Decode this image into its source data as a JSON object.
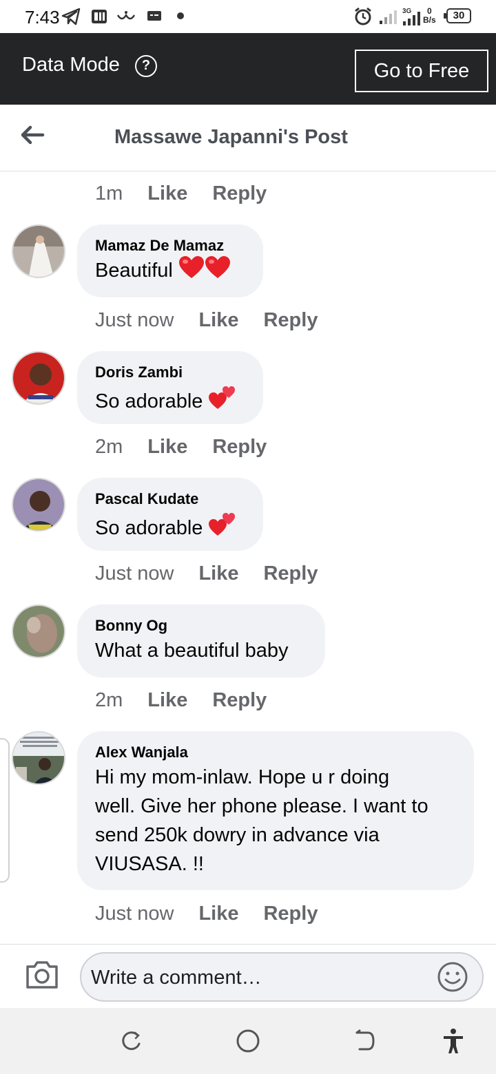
{
  "status_bar": {
    "time": "7:43",
    "net_speed": "0",
    "net_unit": "B/s",
    "net_type": "3G",
    "battery": "30"
  },
  "data_mode": {
    "label": "Data Mode",
    "help_glyph": "?",
    "go_free_label": "Go to Free"
  },
  "header": {
    "title": "Massawe Japanni's Post"
  },
  "comments": [
    {
      "author": "",
      "text": "",
      "time": "1m",
      "like": "Like",
      "reply": "Reply"
    },
    {
      "author": "Mamaz De Mamaz",
      "text": "Beautiful",
      "emoji": "red-heart-x2",
      "time": "Just now",
      "like": "Like",
      "reply": "Reply"
    },
    {
      "author": "Doris Zambi",
      "text": "So adorable",
      "emoji": "two-hearts",
      "time": "2m",
      "like": "Like",
      "reply": "Reply"
    },
    {
      "author": "Pascal Kudate",
      "text": "So adorable",
      "emoji": "two-hearts",
      "time": "Just now",
      "like": "Like",
      "reply": "Reply"
    },
    {
      "author": "Bonny Og",
      "text": "What a beautiful baby",
      "time": "2m",
      "like": "Like",
      "reply": "Reply"
    },
    {
      "author": "Alex Wanjala",
      "text_lines": [
        "Hi my mom-inlaw. Hope u r doing",
        "well. Give her phone please. I want to",
        "send 250k dowry in advance via",
        "VIUSASA. !!"
      ],
      "time": "Just now",
      "like": "Like",
      "reply": "Reply"
    }
  ],
  "composer": {
    "placeholder": "Write a comment…"
  },
  "colors": {
    "banner_bg": "#242526",
    "bubble_bg": "#f0f2f5",
    "meta_text": "#65676b",
    "heart_red": "#e8202a"
  }
}
